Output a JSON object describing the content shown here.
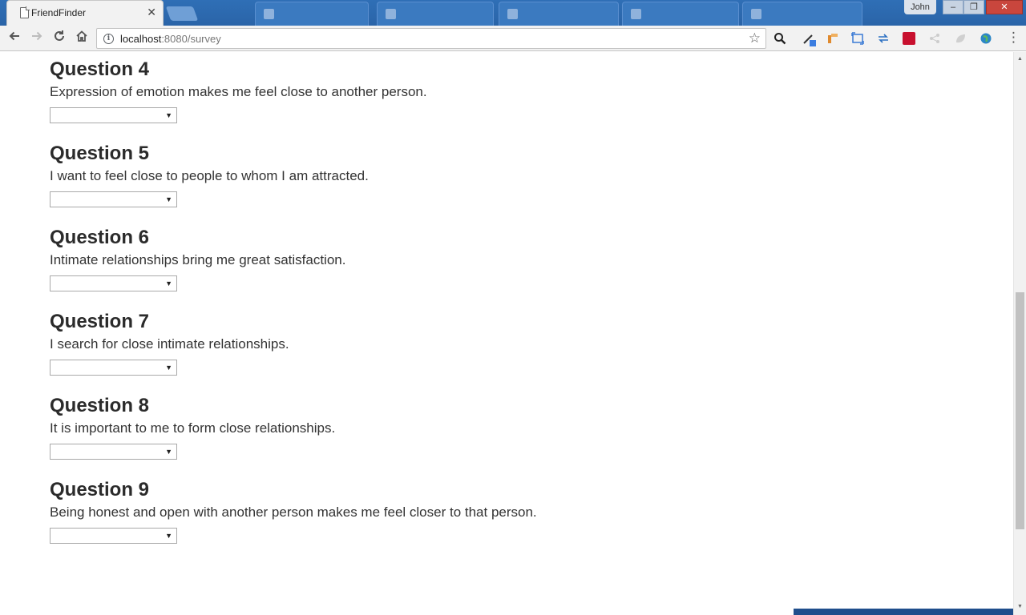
{
  "browser": {
    "active_tab": {
      "title": "FriendFinder"
    },
    "profile_name": "John",
    "window_controls": {
      "minimize": "‒",
      "restore": "❐",
      "close": "✕"
    },
    "url": {
      "host": "localhost",
      "path": ":8080/survey"
    }
  },
  "survey": {
    "questions": [
      {
        "heading": "Question 4",
        "text": "Expression of emotion makes me feel close to another person.",
        "selected": ""
      },
      {
        "heading": "Question 5",
        "text": "I want to feel close to people to whom I am attracted.",
        "selected": ""
      },
      {
        "heading": "Question 6",
        "text": "Intimate relationships bring me great satisfaction.",
        "selected": ""
      },
      {
        "heading": "Question 7",
        "text": "I search for close intimate relationships.",
        "selected": ""
      },
      {
        "heading": "Question 8",
        "text": "It is important to me to form close relationships.",
        "selected": ""
      },
      {
        "heading": "Question 9",
        "text": "Being honest and open with another person makes me feel closer to that person.",
        "selected": ""
      }
    ]
  },
  "icons": {
    "back": "arrow-left-icon",
    "forward": "arrow-right-icon",
    "reload": "reload-icon",
    "home": "home-icon",
    "info": "info-icon",
    "bookmark": "star-icon",
    "search_ext": "magnifier-icon",
    "menu": "kebab-menu-icon"
  },
  "colors": {
    "tabstrip": "#2a64a8",
    "toolbar": "#f2f2f2",
    "close_button": "#c9463d",
    "heading_text": "#2b2b2b"
  }
}
